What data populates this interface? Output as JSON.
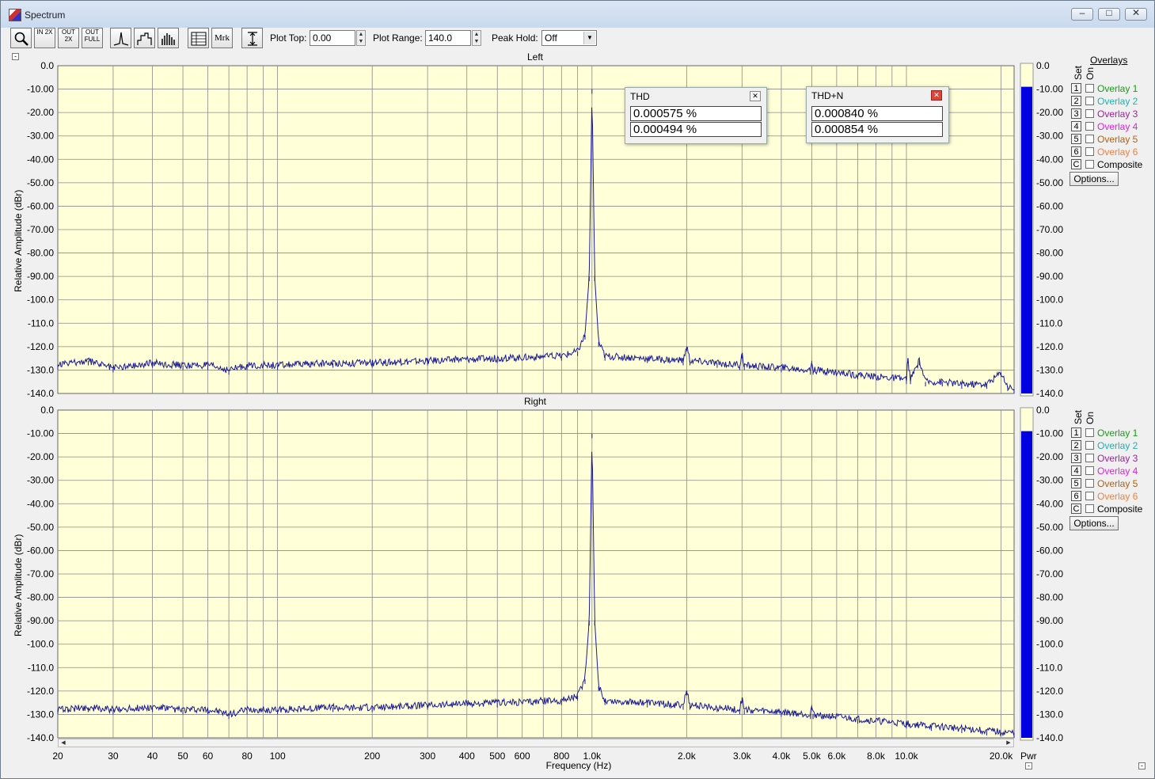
{
  "window": {
    "title": "Spectrum"
  },
  "toolbar": {
    "buttons": [
      {
        "name": "zoom-button",
        "label": ""
      },
      {
        "name": "zoom-in-2x-button",
        "label": "IN 2X"
      },
      {
        "name": "zoom-out-2x-button",
        "label": "OUT 2X"
      },
      {
        "name": "zoom-out-full-button",
        "label": "OUT FULL"
      },
      {
        "name": "line-plot-button",
        "label": ""
      },
      {
        "name": "step-plot-button",
        "label": ""
      },
      {
        "name": "bar-plot-button",
        "label": ""
      },
      {
        "name": "table-view-button",
        "label": ""
      },
      {
        "name": "marker-button",
        "label": "Mrk"
      },
      {
        "name": "autoscale-button",
        "label": ""
      }
    ],
    "plot_top_label": "Plot Top:",
    "plot_top_value": "0.00",
    "plot_range_label": "Plot Range:",
    "plot_range_value": "140.0",
    "peak_hold_label": "Peak Hold:",
    "peak_hold_value": "Off"
  },
  "overlays": {
    "heading": "Overlays",
    "set_label": "Set",
    "on_label": "On",
    "items": [
      {
        "set": "1",
        "name": "Overlay 1",
        "color": "#1a9a1a"
      },
      {
        "set": "2",
        "name": "Overlay 2",
        "color": "#20b0b0"
      },
      {
        "set": "3",
        "name": "Overlay 3",
        "color": "#a020a0"
      },
      {
        "set": "4",
        "name": "Overlay 4",
        "color": "#e020e0"
      },
      {
        "set": "5",
        "name": "Overlay 5",
        "color": "#b06018"
      },
      {
        "set": "6",
        "name": "Overlay 6",
        "color": "#f08040"
      },
      {
        "set": "C",
        "name": "Composite",
        "color": "#000000"
      }
    ],
    "options_label": "Options..."
  },
  "thd": {
    "title": "THD",
    "left": "0.000575 %",
    "right": "0.000494 %"
  },
  "thdn": {
    "title": "THD+N",
    "left": "0.000840 %",
    "right": "0.000854 %"
  },
  "meter": {
    "label": "Pwr",
    "ticks": [
      "0.0",
      "-10.00",
      "-20.00",
      "-30.00",
      "-40.00",
      "-50.00",
      "-60.00",
      "-70.00",
      "-80.00",
      "-90.00",
      "-100.0",
      "-110.0",
      "-120.0",
      "-130.0",
      "-140.0"
    ],
    "left_level_db": -9,
    "right_level_db": -9,
    "bar_color": "#0000e0"
  },
  "chart_data": [
    {
      "type": "line",
      "title": "Left",
      "ylabel": "Relative Amplitude (dBr)",
      "xlabel": "",
      "xscale": "log",
      "xlim": [
        20,
        22000
      ],
      "ylim": [
        -140,
        0
      ],
      "yticks": [
        "0.0",
        "-10.00",
        "-20.00",
        "-30.00",
        "-40.00",
        "-50.00",
        "-60.00",
        "-70.00",
        "-80.00",
        "-90.00",
        "-100.0",
        "-110.0",
        "-120.0",
        "-130.0",
        "-140.0"
      ],
      "grid": true,
      "background": "#ffffd8",
      "line_color": "#1a1a9a",
      "series": [
        {
          "points": [
            [
              20,
              -128
            ],
            [
              25,
              -126
            ],
            [
              30,
              -129
            ],
            [
              40,
              -127
            ],
            [
              50,
              -128
            ],
            [
              60,
              -128
            ],
            [
              70,
              -130
            ],
            [
              80,
              -128
            ],
            [
              100,
              -128
            ],
            [
              150,
              -127
            ],
            [
              200,
              -127
            ],
            [
              300,
              -126
            ],
            [
              500,
              -125
            ],
            [
              800,
              -124
            ],
            [
              900,
              -122
            ],
            [
              950,
              -115
            ],
            [
              980,
              -90
            ],
            [
              1000,
              -10
            ],
            [
              1020,
              -90
            ],
            [
              1050,
              -118
            ],
            [
              1100,
              -124
            ],
            [
              1500,
              -125
            ],
            [
              1950,
              -126
            ],
            [
              2000,
              -120
            ],
            [
              2050,
              -126
            ],
            [
              2500,
              -127
            ],
            [
              2950,
              -128
            ],
            [
              3000,
              -123
            ],
            [
              3050,
              -128
            ],
            [
              4000,
              -129
            ],
            [
              4950,
              -130
            ],
            [
              5000,
              -126
            ],
            [
              5050,
              -130
            ],
            [
              7000,
              -132
            ],
            [
              10000,
              -134
            ],
            [
              10100,
              -125
            ],
            [
              10300,
              -134
            ],
            [
              11000,
              -126
            ],
            [
              11500,
              -135
            ],
            [
              13000,
              -135
            ],
            [
              15000,
              -136
            ],
            [
              18000,
              -136
            ],
            [
              20000,
              -131
            ],
            [
              21000,
              -137
            ],
            [
              22000,
              -138
            ]
          ]
        }
      ]
    },
    {
      "type": "line",
      "title": "Right",
      "ylabel": "Relative Amplitude (dBr)",
      "xlabel": "Frequency (Hz)",
      "xscale": "log",
      "xlim": [
        20,
        22000
      ],
      "ylim": [
        -140,
        0
      ],
      "xticks": [
        {
          "value": 20,
          "label": "20"
        },
        {
          "value": 30,
          "label": "30"
        },
        {
          "value": 40,
          "label": "40"
        },
        {
          "value": 50,
          "label": "50"
        },
        {
          "value": 60,
          "label": "60"
        },
        {
          "value": 80,
          "label": "80"
        },
        {
          "value": 100,
          "label": "100"
        },
        {
          "value": 200,
          "label": "200"
        },
        {
          "value": 300,
          "label": "300"
        },
        {
          "value": 400,
          "label": "400"
        },
        {
          "value": 500,
          "label": "500"
        },
        {
          "value": 600,
          "label": "600"
        },
        {
          "value": 800,
          "label": "800"
        },
        {
          "value": 1000,
          "label": "1.0k"
        },
        {
          "value": 2000,
          "label": "2.0k"
        },
        {
          "value": 3000,
          "label": "3.0k"
        },
        {
          "value": 4000,
          "label": "4.0k"
        },
        {
          "value": 5000,
          "label": "5.0k"
        },
        {
          "value": 6000,
          "label": "6.0k"
        },
        {
          "value": 8000,
          "label": "8.0k"
        },
        {
          "value": 10000,
          "label": "10.0k"
        },
        {
          "value": 20000,
          "label": "20.0k"
        }
      ],
      "yticks": [
        "0.0",
        "-10.00",
        "-20.00",
        "-30.00",
        "-40.00",
        "-50.00",
        "-60.00",
        "-70.00",
        "-80.00",
        "-90.00",
        "-100.0",
        "-110.0",
        "-120.0",
        "-130.0",
        "-140.0"
      ],
      "grid": true,
      "background": "#ffffd8",
      "line_color": "#1a1a9a",
      "series": [
        {
          "points": [
            [
              20,
              -128
            ],
            [
              25,
              -127
            ],
            [
              30,
              -128
            ],
            [
              40,
              -127
            ],
            [
              50,
              -128
            ],
            [
              60,
              -128
            ],
            [
              70,
              -130
            ],
            [
              80,
              -128
            ],
            [
              100,
              -128
            ],
            [
              150,
              -127
            ],
            [
              200,
              -127
            ],
            [
              300,
              -126
            ],
            [
              500,
              -125
            ],
            [
              800,
              -124
            ],
            [
              900,
              -122
            ],
            [
              950,
              -115
            ],
            [
              980,
              -90
            ],
            [
              1000,
              -10
            ],
            [
              1020,
              -90
            ],
            [
              1050,
              -118
            ],
            [
              1100,
              -124
            ],
            [
              1500,
              -125
            ],
            [
              1950,
              -126
            ],
            [
              2000,
              -120
            ],
            [
              2050,
              -126
            ],
            [
              2500,
              -127
            ],
            [
              2950,
              -128
            ],
            [
              3000,
              -123
            ],
            [
              3050,
              -128
            ],
            [
              4000,
              -129
            ],
            [
              4950,
              -130
            ],
            [
              5000,
              -126
            ],
            [
              5050,
              -130
            ],
            [
              7000,
              -132
            ],
            [
              10000,
              -134
            ],
            [
              12000,
              -135
            ],
            [
              15000,
              -136
            ],
            [
              18000,
              -137
            ],
            [
              22000,
              -138
            ]
          ]
        }
      ]
    }
  ]
}
